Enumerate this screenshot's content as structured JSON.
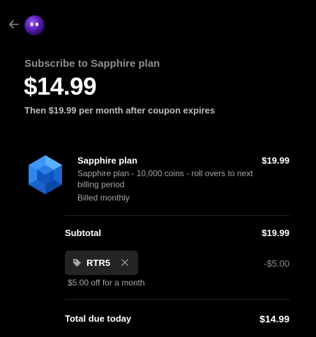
{
  "header": {
    "back_icon": "arrow-left-icon",
    "avatar_icon": "purple-orb-avatar"
  },
  "summary": {
    "subscribe_text": "Subscribe to Sapphire plan",
    "price": "$14.99",
    "after_coupon_text": "Then $19.99 per month after coupon expires"
  },
  "item": {
    "icon": "sapphire-gem-icon",
    "name": "Sapphire plan",
    "description": "Sapphire plan - 10,000 coins - roll overs to next billing period",
    "billing": "Billed monthly",
    "price": "$19.99"
  },
  "subtotal": {
    "label": "Subtotal",
    "value": "$19.99"
  },
  "coupon": {
    "icon": "tag-icon",
    "code": "RTR5",
    "remove_icon": "close-icon",
    "discount": "-$5.00",
    "note": "$5.00 off for a month"
  },
  "total": {
    "label": "Total due today",
    "value": "$14.99"
  },
  "colors": {
    "background": "#000000",
    "text_primary": "#ffffff",
    "text_muted": "#a6a6a6",
    "chip_background": "#242424",
    "gem_blue": "#1f7ae0"
  }
}
